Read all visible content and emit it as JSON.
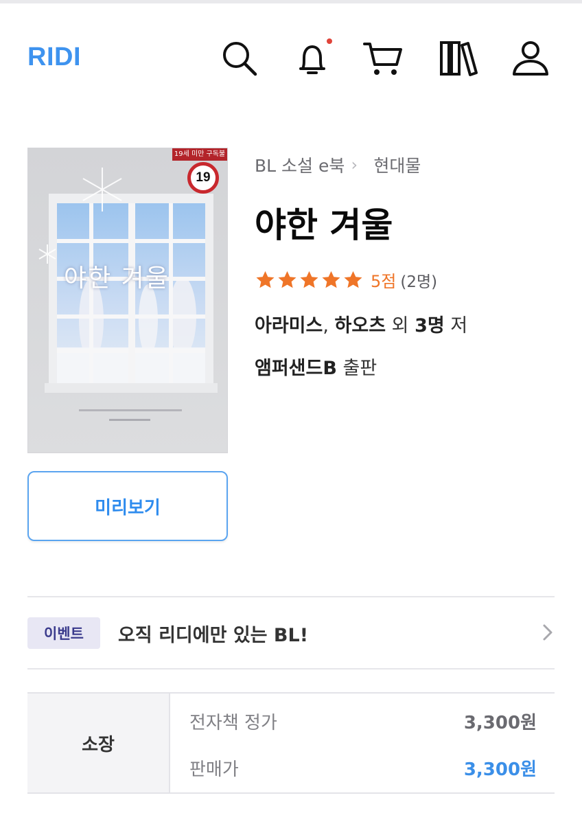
{
  "header": {
    "logo": "RIDI",
    "icons": [
      "search-icon",
      "bell-icon",
      "cart-icon",
      "library-icon",
      "user-icon"
    ],
    "notification_dot": true
  },
  "cover": {
    "age_banner": "19세 미만 구독불가",
    "age_badge": "19",
    "title_on_cover": "야한 겨울"
  },
  "preview_label": "미리보기",
  "breadcrumb": [
    "BL 소설 e북",
    "현대물"
  ],
  "book": {
    "title": "야한 겨울",
    "rating_stars": 5,
    "rating_score": "5점",
    "rating_count": "(2명)",
    "author_1": "아라미스",
    "author_sep": ", ",
    "author_2": "하오츠",
    "author_mid": " 외 ",
    "author_more": "3명",
    "author_suffix": " 저",
    "publisher": "앰퍼샌드B",
    "publisher_suffix": " 출판"
  },
  "event": {
    "badge": "이벤트",
    "text": "오직 리디에만 있는 BL!"
  },
  "price": {
    "type_label": "소장",
    "list_label": "전자책 정가",
    "list_value": "3,300원",
    "sale_label": "판매가",
    "sale_value": "3,300원"
  },
  "colors": {
    "brand": "#3e93ef",
    "star": "#ef7528",
    "notification": "#e0443a",
    "sale_price": "#3b8fe8"
  }
}
